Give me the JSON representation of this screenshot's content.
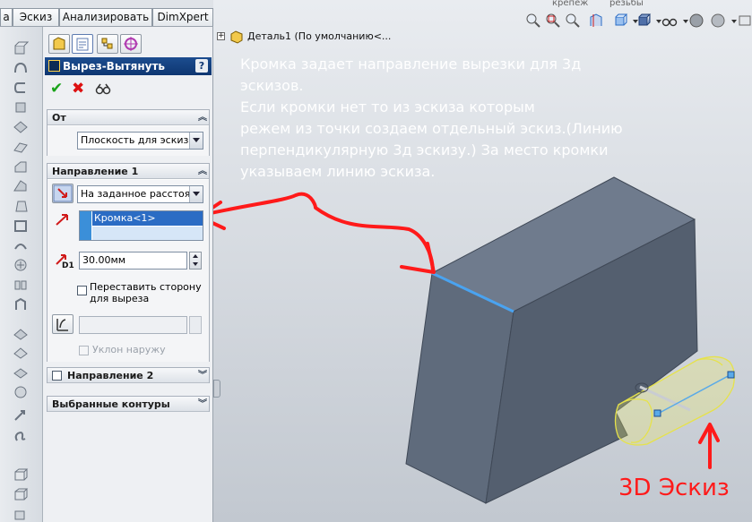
{
  "tabs": [
    "а",
    "Эскиз",
    "Анализировать",
    "DimXpert"
  ],
  "tree": {
    "title": "Деталь1  (По умолчанию<..."
  },
  "view_labels": {
    "left": "крепеж",
    "right": "резьбы"
  },
  "property_manager": {
    "title": "Вырез-Вытянуть",
    "help": "?",
    "ok": "✔",
    "cancel": "✖",
    "from": {
      "header": "От",
      "value": "Плоскость для эскиза"
    },
    "direction1": {
      "header": "Направление 1",
      "end_condition": "На заданное расстоянии",
      "selection": "Кромка<1>",
      "depth": "30.00мм",
      "depth_icon_label": "D1",
      "flip_side_line1": "Переставить сторону",
      "flip_side_line2": "для выреза",
      "draft_outward": "Уклон наружу"
    },
    "direction2": {
      "header": "Направление 2"
    },
    "selected_contours": {
      "header": "Выбранные контуры"
    }
  },
  "annotation": {
    "lines": [
      "Кромка задает направление вырезки для 3д",
      "эскизов.",
      "Если кромки нет то из эскиза которым",
      "режем из точки создаем отдельный эскиз.(Линию",
      "перпендикулярную  3д эскизу.) За место кромки",
      "указываем линию эскиза."
    ],
    "label_3d": "3D Эскиз"
  },
  "colors": {
    "viewport_bg": "#d4d8de",
    "box_front": "#5f6b7c",
    "box_top": "#6f7b8d",
    "box_side": "#545f6f",
    "highlight_edge": "#4aa3f0",
    "sketch": "#f0ee60",
    "annotation_red": "#ff1a1a",
    "title_bar": "#1c4d8f"
  }
}
